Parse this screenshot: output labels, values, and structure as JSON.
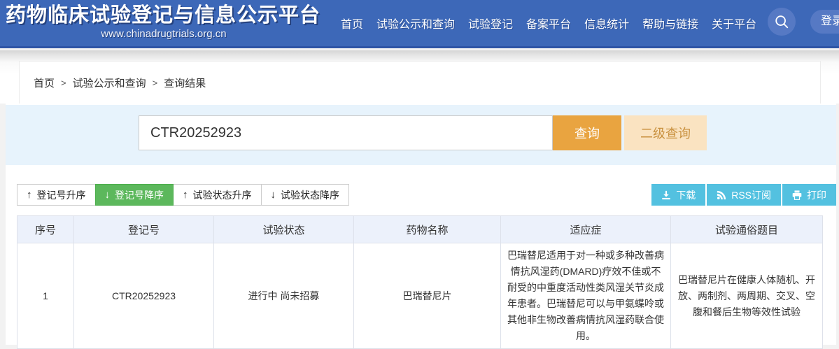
{
  "header": {
    "title": "药物临床试验登记与信息公示平台",
    "url": "www.chinadrugtrials.org.cn",
    "nav": [
      "首页",
      "试验公示和查询",
      "试验登记",
      "备案平台",
      "信息统计",
      "帮助与链接",
      "关于平台"
    ],
    "login_label": "登录"
  },
  "breadcrumb": {
    "items": [
      "首页",
      "试验公示和查询",
      "查询结果"
    ],
    "separator": ">"
  },
  "search": {
    "value": "CTR20252923",
    "query_button": "查询",
    "secondary_query_button": "二级查询"
  },
  "sorting": {
    "buttons": [
      {
        "label": "登记号升序",
        "arrow": "↑",
        "active": false
      },
      {
        "label": "登记号降序",
        "arrow": "↓",
        "active": true
      },
      {
        "label": "试验状态升序",
        "arrow": "↑",
        "active": false
      },
      {
        "label": "试验状态降序",
        "arrow": "↓",
        "active": false
      }
    ]
  },
  "tools": {
    "download": "下载",
    "rss": "RSS订阅",
    "print": "打印"
  },
  "results_table": {
    "headers": [
      "序号",
      "登记号",
      "试验状态",
      "药物名称",
      "适应症",
      "试验通俗题目"
    ],
    "rows": [
      {
        "seq": "1",
        "registration_no": "CTR20252923",
        "status": "进行中 尚未招募",
        "drug_name": "巴瑞替尼片",
        "indication": "巴瑞替尼适用于对一种或多种改善病情抗风湿药(DMARD)疗效不佳或不耐受的中重度活动性类风湿关节炎成年患者。巴瑞替尼可以与甲氨蝶呤或其他非生物改善病情抗风湿药联合使用。",
        "public_title": "巴瑞替尼片在健康人体随机、开放、两制剂、两周期、交叉、空腹和餐后生物等效性试验"
      }
    ]
  },
  "colors": {
    "header_blue": "#3d68b8",
    "header_accent_blue": "#5679c4",
    "accent_orange": "#e9a440",
    "secondary_orange_bg": "#fae3c1",
    "active_green": "#5cb85c",
    "tool_blue": "#53c1e0",
    "search_band_bg": "#e7f3fc",
    "table_header_bg": "#ecf1fb"
  }
}
